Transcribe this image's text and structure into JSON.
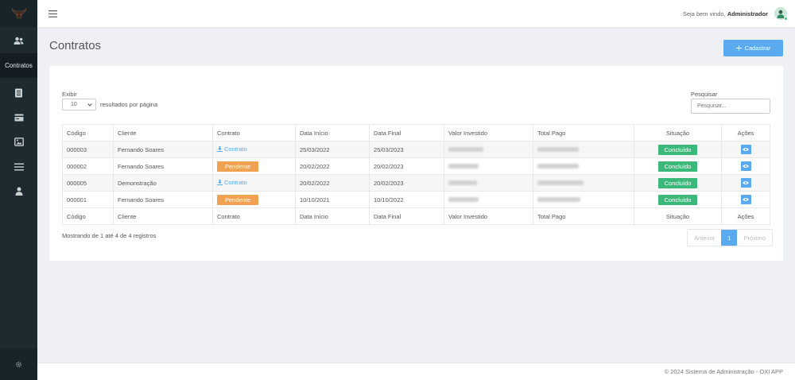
{
  "sidebar": {
    "items": [
      {
        "icon": "users-icon",
        "label": ""
      },
      {
        "icon": "",
        "label": "Contratos"
      },
      {
        "icon": "document-icon",
        "label": ""
      },
      {
        "icon": "card-icon",
        "label": ""
      },
      {
        "icon": "image-icon",
        "label": ""
      },
      {
        "icon": "list-icon",
        "label": ""
      },
      {
        "icon": "user-icon",
        "label": ""
      }
    ],
    "footer_icon": "gear-icon"
  },
  "header": {
    "welcome": "Seja bem vindo,",
    "user": "Administrador"
  },
  "page": {
    "title": "Contratos",
    "add_button": "Cadastrar"
  },
  "filters": {
    "show_label": "Exibir",
    "page_size": "10",
    "per_page_label": "resultados por página",
    "search_label": "Pesquisar",
    "search_placeholder": "Pesquisar..."
  },
  "table": {
    "columns": [
      "Código",
      "Cliente",
      "Contrato",
      "Data Início",
      "Data Final",
      "Valor Investido",
      "Total Pago",
      "Situação",
      "Ações"
    ],
    "link_label": "Contrato",
    "rows": [
      {
        "code": "000003",
        "client": "Fernando Soares",
        "contract": "Contrato",
        "contract_type": "link",
        "start": "25/03/2022",
        "end": "25/03/2023",
        "status": "Concluído"
      },
      {
        "code": "000002",
        "client": "Fernando Soares",
        "contract": "Pendente",
        "contract_type": "badge",
        "start": "20/02/2022",
        "end": "20/02/2023",
        "status": "Concluído"
      },
      {
        "code": "000005",
        "client": "Demonstração",
        "contract": "Contrato",
        "contract_type": "link",
        "start": "20/02/2022",
        "end": "20/02/2023",
        "status": "Concluído"
      },
      {
        "code": "000001",
        "client": "Fernando Soares",
        "contract": "Pendente",
        "contract_type": "badge",
        "start": "10/10/2021",
        "end": "10/10/2022",
        "status": "Concluído"
      }
    ]
  },
  "pagination": {
    "info": "Mostrando de 1 até 4 de 4 registros",
    "prev": "Anterior",
    "current": "1",
    "next": "Próximo"
  },
  "footer": {
    "text": "© 2024 Sistema de Administração - OXI APP"
  },
  "colors": {
    "sidebar": "#1e2a30",
    "primary": "#5aaaf0",
    "success": "#3ab97a",
    "warning": "#f0a252"
  }
}
